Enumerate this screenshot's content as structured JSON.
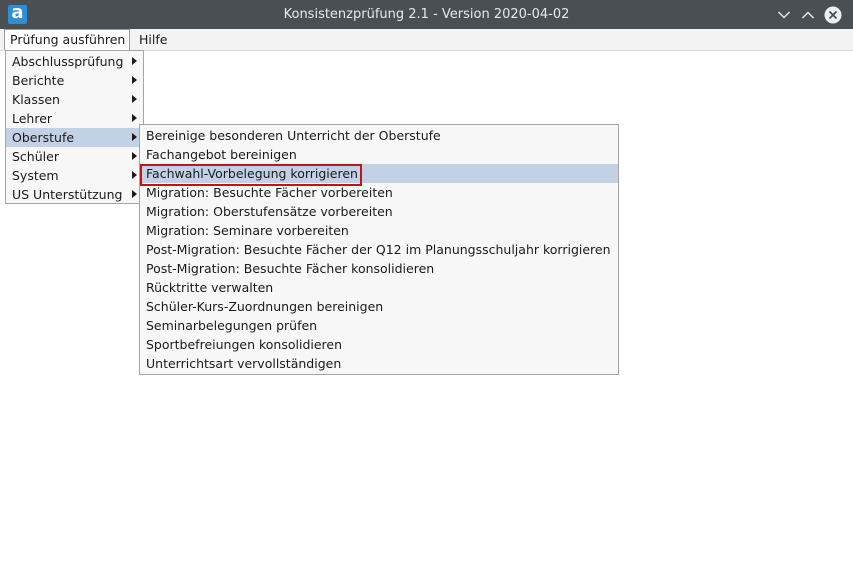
{
  "window": {
    "title": "Konsistenzprüfung 2.1 - Version 2020-04-02",
    "logo_letter": "a",
    "logo_color": "#2b8fd6",
    "titlebar_color": "#4a4f54",
    "controls": [
      "minimize-icon",
      "maximize-icon",
      "close-icon"
    ]
  },
  "menubar": {
    "items": [
      {
        "label": "Prüfung ausführen",
        "active": true
      },
      {
        "label": "Hilfe",
        "active": false
      }
    ]
  },
  "menu": {
    "items": [
      {
        "label": "Abschlussprüfung",
        "submenu": true
      },
      {
        "label": "Berichte",
        "submenu": true
      },
      {
        "label": "Klassen",
        "submenu": true
      },
      {
        "label": "Lehrer",
        "submenu": true
      },
      {
        "label": "Oberstufe",
        "submenu": true,
        "highlighted": true
      },
      {
        "label": "Schüler",
        "submenu": true
      },
      {
        "label": "System",
        "submenu": true
      },
      {
        "label": "US Unterstützung",
        "submenu": true
      }
    ]
  },
  "submenu": {
    "parent": "Oberstufe",
    "items": [
      {
        "label": "Bereinige besonderen Unterricht der Oberstufe"
      },
      {
        "label": "Fachangebot bereinigen"
      },
      {
        "label": "Fachwahl-Vorbelegung korrigieren",
        "highlighted": true,
        "outlined": true
      },
      {
        "label": "Migration: Besuchte Fächer vorbereiten"
      },
      {
        "label": "Migration: Oberstufensätze vorbereiten"
      },
      {
        "label": "Migration: Seminare vorbereiten"
      },
      {
        "label": "Post-Migration: Besuchte Fächer der Q12 im Planungsschuljahr korrigieren"
      },
      {
        "label": "Post-Migration: Besuchte Fächer konsolidieren"
      },
      {
        "label": "Rücktritte verwalten"
      },
      {
        "label": "Schüler-Kurs-Zuordnungen bereinigen"
      },
      {
        "label": "Seminarbelegungen prüfen"
      },
      {
        "label": "Sportbefreiungen konsolidieren"
      },
      {
        "label": "Unterrichtsart vervollständigen"
      }
    ]
  },
  "colors": {
    "highlight": "#c3d1e6",
    "outline": "#c0141b"
  }
}
